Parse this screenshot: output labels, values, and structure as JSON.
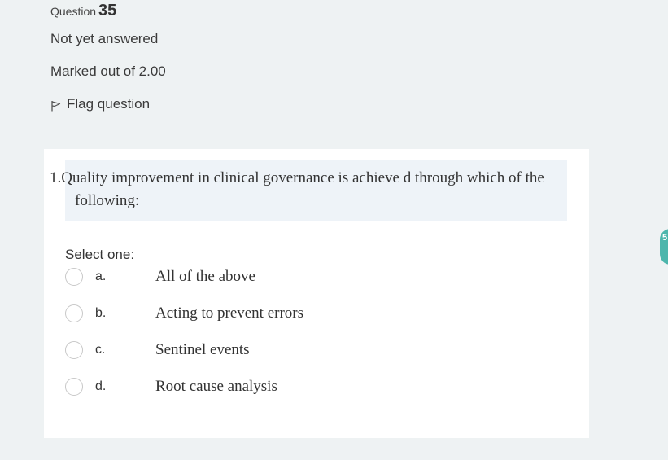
{
  "question_info": {
    "label": "Question",
    "number": "35",
    "state": "Not yet answered",
    "grade": "Marked out of 2.00",
    "flag_label": "Flag question"
  },
  "question": {
    "text": "1.Quality improvement in clinical governance is achieve d through which of the following:",
    "prompt": "Select one:",
    "options": [
      {
        "letter": "a.",
        "text": "All of the above"
      },
      {
        "letter": "b.",
        "text": "Acting to prevent errors"
      },
      {
        "letter": "c.",
        "text": "Sentinel events"
      },
      {
        "letter": "d.",
        "text": "Root cause analysis"
      }
    ]
  },
  "side_badge": {
    "text": "5",
    "color": "#4db6ac"
  },
  "colors": {
    "page_background": "#eef2f3",
    "card_background": "#ffffff",
    "question_text_background": "#eef3f8"
  }
}
